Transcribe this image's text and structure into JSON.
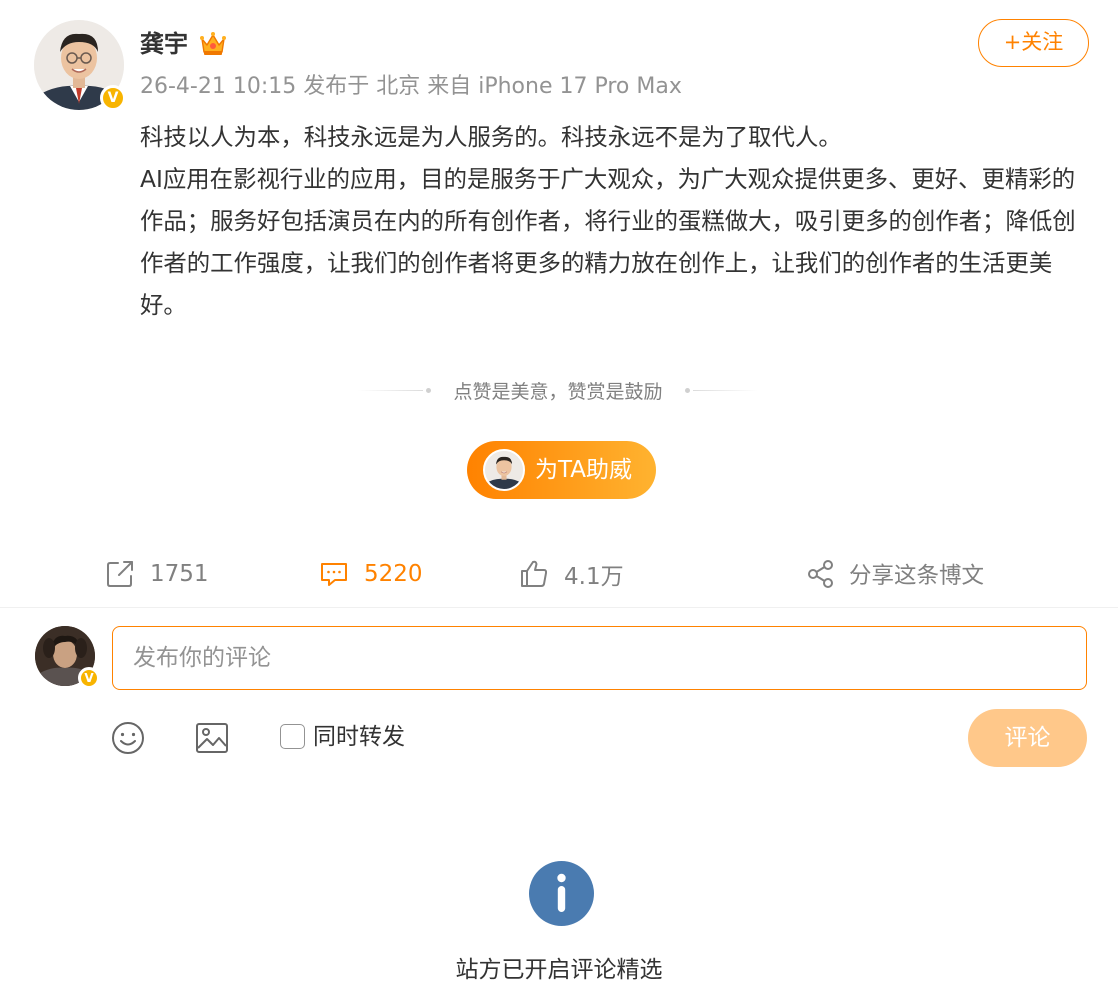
{
  "post": {
    "author": {
      "name": "龚宇",
      "verified": true,
      "badge_icon": "crown-icon",
      "avatar_icon": "user-avatar"
    },
    "meta": "26-4-21 10:15 发布于 北京 来自 iPhone 17 Pro Max",
    "follow_label": "+关注",
    "paragraphs": [
      "科技以人为本，科技永远是为人服务的。科技永远不是为了取代人。",
      "AI应用在影视行业的应用，目的是服务于广大观众，为广大观众提供更多、更好、更精彩的作品；服务好包括演员在内的所有创作者，将行业的蛋糕做大，吸引更多的创作者；降低创作者的工作强度，让我们的创作者将更多的精力放在创作上，让我们的创作者的生活更美好。"
    ]
  },
  "reward": {
    "tip": "点赞是美意，赞赏是鼓励",
    "support_label": "为TA助威"
  },
  "actions": {
    "repost": {
      "count": "1751",
      "icon": "repost-icon"
    },
    "comment": {
      "count": "5220",
      "icon": "comment-icon",
      "active": true
    },
    "like": {
      "count": "4.1万",
      "icon": "thumb-up-icon"
    },
    "share": {
      "label": "分享这条博文",
      "icon": "share-icon"
    }
  },
  "composer": {
    "placeholder": "发布你的评论",
    "repost_label": "同时转发",
    "repost_checked": false,
    "submit_label": "评论",
    "tools": [
      "emoji-icon",
      "image-icon"
    ]
  },
  "notice": {
    "icon": "info-icon",
    "text": "站方已开启评论精选"
  },
  "colors": {
    "accent": "#ff8200",
    "accent_light": "#ffc88a",
    "meta_gray": "#939393",
    "text": "#333333",
    "verified_badge": "#f8b400",
    "info_blue": "#4a7bb0"
  }
}
